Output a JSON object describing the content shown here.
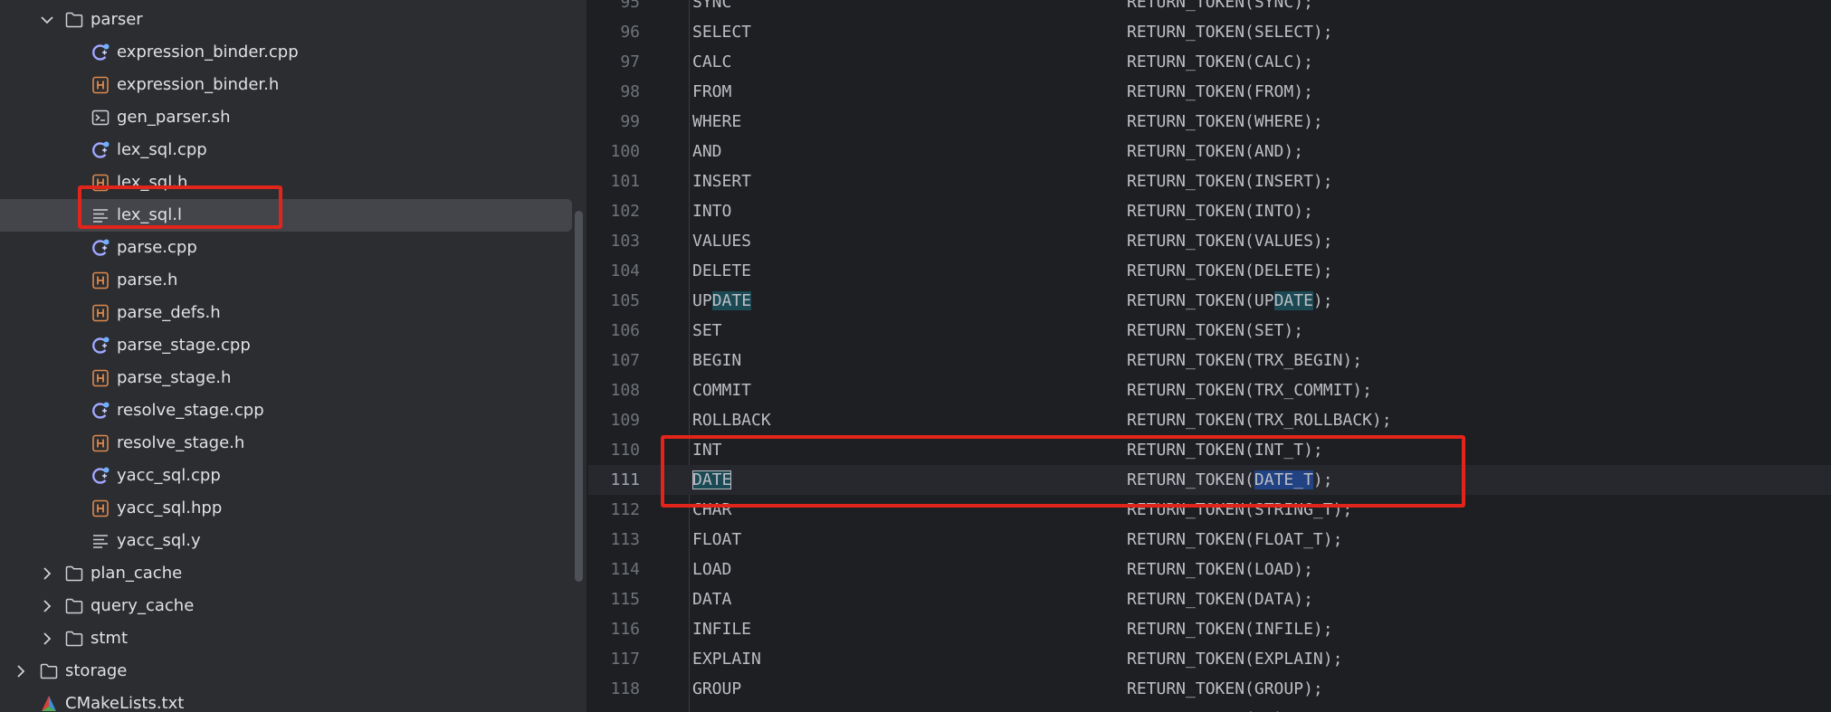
{
  "tree": {
    "folder_parser": "parser",
    "files": [
      {
        "name": "expression_binder.cpp",
        "icon": "cpp-file-icon"
      },
      {
        "name": "expression_binder.h",
        "icon": "header-file-icon"
      },
      {
        "name": "gen_parser.sh",
        "icon": "shell-script-icon"
      },
      {
        "name": "lex_sql.cpp",
        "icon": "cpp-file-icon"
      },
      {
        "name": "lex_sql.h",
        "icon": "header-file-icon"
      },
      {
        "name": "lex_sql.l",
        "icon": "text-file-icon"
      },
      {
        "name": "parse.cpp",
        "icon": "cpp-file-icon"
      },
      {
        "name": "parse.h",
        "icon": "header-file-icon"
      },
      {
        "name": "parse_defs.h",
        "icon": "header-file-icon"
      },
      {
        "name": "parse_stage.cpp",
        "icon": "cpp-file-icon"
      },
      {
        "name": "parse_stage.h",
        "icon": "header-file-icon"
      },
      {
        "name": "resolve_stage.cpp",
        "icon": "cpp-file-icon"
      },
      {
        "name": "resolve_stage.h",
        "icon": "header-file-icon"
      },
      {
        "name": "yacc_sql.cpp",
        "icon": "cpp-file-icon"
      },
      {
        "name": "yacc_sql.hpp",
        "icon": "header-file-icon"
      },
      {
        "name": "yacc_sql.y",
        "icon": "text-file-icon"
      }
    ],
    "folder_plan_cache": "plan_cache",
    "folder_query_cache": "query_cache",
    "folder_stmt": "stmt",
    "folder_storage": "storage",
    "file_cmakelists": "CMakeLists.txt"
  },
  "editor": {
    "lines": [
      {
        "num": "95",
        "kw": "SYNC",
        "act": "RETURN_TOKEN(SYNC);"
      },
      {
        "num": "96",
        "kw": "SELECT",
        "act": "RETURN_TOKEN(SELECT);"
      },
      {
        "num": "97",
        "kw": "CALC",
        "act": "RETURN_TOKEN(CALC);"
      },
      {
        "num": "98",
        "kw": "FROM",
        "act": "RETURN_TOKEN(FROM);"
      },
      {
        "num": "99",
        "kw": "WHERE",
        "act": "RETURN_TOKEN(WHERE);"
      },
      {
        "num": "100",
        "kw": "AND",
        "act": "RETURN_TOKEN(AND);"
      },
      {
        "num": "101",
        "kw": "INSERT",
        "act": "RETURN_TOKEN(INSERT);"
      },
      {
        "num": "102",
        "kw": "INTO",
        "act": "RETURN_TOKEN(INTO);"
      },
      {
        "num": "103",
        "kw": "VALUES",
        "act": "RETURN_TOKEN(VALUES);"
      },
      {
        "num": "104",
        "kw": "DELETE",
        "act": "RETURN_TOKEN(DELETE);"
      },
      {
        "num": "105",
        "kw_pre": "UP",
        "kw_hl": "DATE",
        "act_pre": "RETURN_TOKEN(UP",
        "act_hl": "DATE",
        "act_post": ");"
      },
      {
        "num": "106",
        "kw": "SET",
        "act": "RETURN_TOKEN(SET);"
      },
      {
        "num": "107",
        "kw": "BEGIN",
        "act": "RETURN_TOKEN(TRX_BEGIN);"
      },
      {
        "num": "108",
        "kw": "COMMIT",
        "act": "RETURN_TOKEN(TRX_COMMIT);"
      },
      {
        "num": "109",
        "kw": "ROLLBACK",
        "act": "RETURN_TOKEN(TRX_ROLLBACK);"
      },
      {
        "num": "110",
        "kw": "INT",
        "act": "RETURN_TOKEN(INT_T);"
      },
      {
        "num": "111",
        "kw_sel": "DATE",
        "act_pre": "RETURN_TOKEN(",
        "act_hl": "DATE_T",
        "act_post": ");"
      },
      {
        "num": "112",
        "kw": "CHAR",
        "act": "RETURN_TOKEN(STRING_T);"
      },
      {
        "num": "113",
        "kw": "FLOAT",
        "act": "RETURN_TOKEN(FLOAT_T);"
      },
      {
        "num": "114",
        "kw": "LOAD",
        "act": "RETURN_TOKEN(LOAD);"
      },
      {
        "num": "115",
        "kw": "DATA",
        "act": "RETURN_TOKEN(DATA);"
      },
      {
        "num": "116",
        "kw": "INFILE",
        "act": "RETURN_TOKEN(INFILE);"
      },
      {
        "num": "117",
        "kw": "EXPLAIN",
        "act": "RETURN_TOKEN(EXPLAIN);"
      },
      {
        "num": "118",
        "kw": "GROUP",
        "act": "RETURN_TOKEN(GROUP);"
      },
      {
        "num": "",
        "kw": "",
        "act": "RETURN_TOKEN(BY);"
      }
    ]
  },
  "colors": {
    "tree_bg": "#2b2d30",
    "editor_bg": "#1e1f22",
    "selection_row": "#43454a",
    "annotation_red": "#e1251b",
    "occurrence_highlight": "#1b4a55",
    "strong_highlight": "#214283"
  }
}
